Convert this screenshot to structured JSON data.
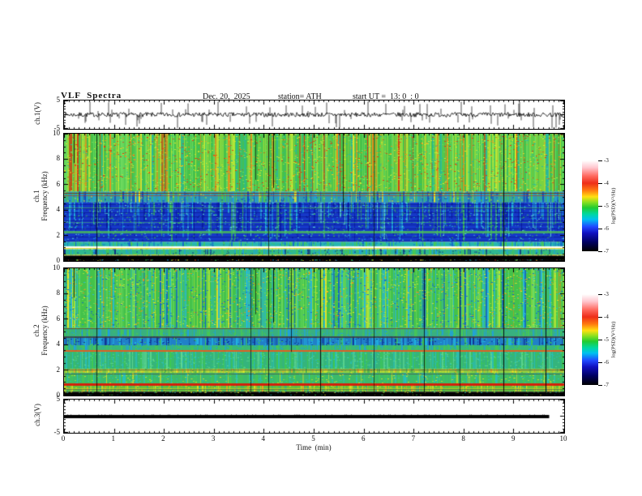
{
  "header": {
    "title": "VLF  Spectra",
    "date": "Dec. 20,  2025",
    "station": "station= ATH",
    "start_ut": "start UT =  13: 0  : 0"
  },
  "axes": {
    "time": {
      "label": "Time  (min)",
      "range": [
        0,
        10
      ],
      "ticks": [
        "0",
        "1",
        "2",
        "3",
        "4",
        "5",
        "6",
        "7",
        "8",
        "9",
        "10"
      ],
      "minor_step": 0.1
    },
    "ch1v": {
      "label": "ch.1(V)",
      "range": [
        -5,
        5
      ],
      "ticks": [
        "5",
        "-5"
      ],
      "tick_values": [
        5,
        -5
      ]
    },
    "ch1f": {
      "label_line1": "ch.1",
      "label_line2": "Frequency  (kHz)",
      "range": [
        0,
        10
      ],
      "ticks": [
        "10",
        "8",
        "6",
        "4",
        "2",
        "0"
      ],
      "tick_values": [
        10,
        8,
        6,
        4,
        2,
        0
      ],
      "minor_step": 0.5
    },
    "ch2f": {
      "label_line1": "ch.2",
      "label_line2": "Frequency  (kHz)",
      "range": [
        0,
        10
      ],
      "ticks": [
        "10",
        "8",
        "6",
        "4",
        "2",
        "0"
      ],
      "tick_values": [
        10,
        8,
        6,
        4,
        2,
        0
      ],
      "minor_step": 0.5
    },
    "ch3v": {
      "label": "ch.3(V)",
      "range": [
        -5,
        5
      ],
      "ticks": [
        "5",
        "-5"
      ],
      "tick_values": [
        5,
        -5
      ]
    }
  },
  "colorbar": {
    "label": "log(PSD)(V²/Hz)",
    "ticks": [
      "-3",
      "-4",
      "-5",
      "-6",
      "-7"
    ],
    "gradient": [
      [
        "#ffffff",
        0
      ],
      [
        "#ffc6ce",
        8
      ],
      [
        "#ff6a60",
        17
      ],
      [
        "#ee2e18",
        25
      ],
      [
        "#ff7a10",
        33
      ],
      [
        "#ffe010",
        40
      ],
      [
        "#8ae020",
        46
      ],
      [
        "#22cc30",
        52
      ],
      [
        "#00d8a0",
        59
      ],
      [
        "#00c0f0",
        65
      ],
      [
        "#2048ff",
        73
      ],
      [
        "#1010c0",
        80
      ],
      [
        "#000060",
        90
      ],
      [
        "#000000",
        100
      ]
    ]
  },
  "chart_data": [
    {
      "type": "line",
      "name": "ch1-voltage-waveform",
      "xlabel": "Time (min)",
      "xlim": [
        0,
        10
      ],
      "ylabel": "ch.1(V)",
      "ylim": [
        -5,
        5
      ],
      "color": "#000000",
      "seed": 7,
      "baseline": 0,
      "noise_amplitude": 0.8,
      "spike_probability": 0.13,
      "spike_min": 1.2,
      "spike_max": 4.8
    },
    {
      "type": "heatmap",
      "name": "ch1-spectrogram",
      "xlim": [
        0,
        10
      ],
      "f_range": [
        0,
        10
      ],
      "ylabel": "ch.1 Frequency (kHz)",
      "units": "log(PSD)(V²/Hz)",
      "scale_range": [
        -7,
        -3
      ],
      "seed": 11,
      "vseed": 42,
      "vline_prob": 0.035,
      "bands": [
        {
          "f": [
            5.45,
            10.0
          ],
          "base": "#46c24a",
          "mode": "full",
          "noise": 0.35,
          "streaks": [
            [
              "#b8e838",
              0.18
            ],
            [
              "#e8e428",
              0.13
            ],
            [
              "#f09018",
              0.1
            ],
            [
              "#e03410",
              0.07
            ],
            [
              "#70dc60",
              0.22
            ],
            [
              "#28b8a0",
              0.06
            ]
          ]
        },
        {
          "f": [
            4.6,
            5.45
          ],
          "base": "#2f9ab0",
          "mode": "full",
          "noise": 0.3,
          "streaks": [
            [
              "#48c850",
              0.25
            ],
            [
              "#20a0e0",
              0.18
            ],
            [
              "#e8e428",
              0.05
            ],
            [
              "#1040c0",
              0.15
            ]
          ]
        },
        {
          "f": [
            1.5,
            4.6
          ],
          "base": "#1638c8",
          "mode": "top",
          "noise": 0.32,
          "hstripe": {
            "step": 5,
            "color": "#071280",
            "alpha": 0.55
          },
          "streaks": [
            [
              "#20b4e0",
              0.2
            ],
            [
              "#40c850",
              0.12
            ],
            [
              "#0818a0",
              0.18
            ],
            [
              "#60e0d0",
              0.06
            ]
          ]
        },
        {
          "f": [
            1.15,
            1.5
          ],
          "base": "#28b6b0",
          "mode": "full",
          "noise": 0.3,
          "streaks": [
            [
              "#48c850",
              0.3
            ],
            [
              "#1060d0",
              0.15
            ]
          ]
        },
        {
          "f": [
            0.92,
            1.15
          ],
          "base": "#f0f0c0",
          "mode": "full",
          "noise": 0.2,
          "streaks": [
            [
              "#ffffff",
              0.3
            ],
            [
              "#f0e020",
              0.3
            ]
          ]
        },
        {
          "f": [
            0.5,
            0.92
          ],
          "base": "#30b890",
          "mode": "full",
          "noise": 0.35,
          "streaks": [
            [
              "#48c850",
              0.25
            ],
            [
              "#20a0e0",
              0.2
            ],
            [
              "#103080",
              0.1
            ]
          ]
        },
        {
          "f": [
            0.42,
            0.5
          ],
          "base": "#b0d040",
          "mode": "full",
          "noise": 0.2,
          "streaks": [
            [
              "#e0e020",
              0.3
            ],
            [
              "#40a040",
              0.2
            ]
          ]
        },
        {
          "f": [
            0.0,
            0.42
          ],
          "base": "#0a0a0a",
          "mode": "dots",
          "noise": 0.55,
          "streaks": [
            [
              "#40c850",
              0.1
            ],
            [
              "#e03410",
              0.05
            ],
            [
              "#20a0e0",
              0.07
            ],
            [
              "#e8e428",
              0.04
            ]
          ]
        }
      ],
      "hlines": [
        {
          "f": 5.35,
          "color": "#803010",
          "px": 1,
          "alpha": 0.85
        },
        {
          "f": 5.12,
          "color": "#c03818",
          "px": 1,
          "alpha": 0.65
        },
        {
          "f": 4.15,
          "color": "#58d058",
          "px": 1,
          "alpha": 0.55
        },
        {
          "f": 3.05,
          "color": "#58d058",
          "px": 1,
          "alpha": 0.45
        },
        {
          "f": 2.25,
          "color": "#50cc50",
          "px": 3,
          "alpha": 0.75
        },
        {
          "f": 1.1,
          "color": "#ffffff",
          "px": 2,
          "alpha": 0.9
        },
        {
          "f": 0.98,
          "color": "#e8d820",
          "px": 1,
          "alpha": 0.9
        },
        {
          "f": 0.3,
          "color": "#000000",
          "px": 2,
          "alpha": 1
        },
        {
          "f": 0.18,
          "color": "#000000",
          "px": 2,
          "alpha": 1
        }
      ]
    },
    {
      "type": "heatmap",
      "name": "ch2-spectrogram",
      "xlim": [
        0,
        10
      ],
      "f_range": [
        0,
        10
      ],
      "ylabel": "ch.2 Frequency (kHz)",
      "units": "log(PSD)(V²/Hz)",
      "scale_range": [
        -7,
        -3
      ],
      "seed": 23,
      "vseed": 42,
      "vline_prob": 0.05,
      "bands": [
        {
          "f": [
            5.3,
            10.0
          ],
          "base": "#44c24a",
          "mode": "full",
          "noise": 0.35,
          "streaks": [
            [
              "#28b8d8",
              0.22
            ],
            [
              "#1060d0",
              0.12
            ],
            [
              "#b8e838",
              0.12
            ],
            [
              "#e8e428",
              0.07
            ],
            [
              "#70dc60",
              0.2
            ],
            [
              "#f09018",
              0.03
            ]
          ]
        },
        {
          "f": [
            4.65,
            5.3
          ],
          "base": "#38b080",
          "mode": "full",
          "noise": 0.3,
          "streaks": [
            [
              "#48c850",
              0.25
            ],
            [
              "#20a0e0",
              0.2
            ]
          ]
        },
        {
          "f": [
            3.95,
            4.65
          ],
          "base": "#2080c8",
          "mode": "full",
          "noise": 0.35,
          "streaks": [
            [
              "#20b4e0",
              0.25
            ],
            [
              "#103090",
              0.2
            ],
            [
              "#40c850",
              0.1
            ]
          ]
        },
        {
          "f": [
            3.55,
            3.95
          ],
          "base": "#38b878",
          "mode": "full",
          "noise": 0.3,
          "streaks": [
            [
              "#48c850",
              0.3
            ],
            [
              "#20a0e0",
              0.15
            ]
          ]
        },
        {
          "f": [
            2.1,
            3.45
          ],
          "base": "#34b47c",
          "mode": "full",
          "noise": 0.4,
          "streaks": [
            [
              "#40c850",
              0.22
            ],
            [
              "#28c0c0",
              0.25
            ],
            [
              "#60d890",
              0.15
            ]
          ]
        },
        {
          "f": [
            1.78,
            2.1
          ],
          "base": "#90cc40",
          "mode": "full",
          "noise": 0.3,
          "streaks": [
            [
              "#d8e028",
              0.3
            ],
            [
              "#f0a020",
              0.08
            ],
            [
              "#50b048",
              0.2
            ]
          ]
        },
        {
          "f": [
            0.95,
            1.78
          ],
          "base": "#3cba6a",
          "mode": "full",
          "noise": 0.4,
          "streaks": [
            [
              "#48c850",
              0.25
            ],
            [
              "#28c0c0",
              0.18
            ],
            [
              "#d8e028",
              0.07
            ]
          ]
        },
        {
          "f": [
            0.3,
            0.95
          ],
          "base": "#62c23c",
          "mode": "full",
          "noise": 0.35,
          "streaks": [
            [
              "#d8e028",
              0.2
            ],
            [
              "#f0a020",
              0.08
            ],
            [
              "#30b080",
              0.15
            ]
          ]
        },
        {
          "f": [
            0.0,
            0.3
          ],
          "base": "#0a0a0a",
          "mode": "dots",
          "noise": 0.55,
          "streaks": [
            [
              "#40c850",
              0.1
            ],
            [
              "#28c0c0",
              0.08
            ],
            [
              "#d8e028",
              0.05
            ]
          ]
        }
      ],
      "hlines": [
        {
          "f": 5.25,
          "color": "#604020",
          "px": 1,
          "alpha": 0.8
        },
        {
          "f": 4.6,
          "color": "#404040",
          "px": 2,
          "alpha": 0.85
        },
        {
          "f": 3.5,
          "color": "#e05010",
          "px": 2,
          "alpha": 0.9
        },
        {
          "f": 2.0,
          "color": "#484848",
          "px": 1,
          "alpha": 0.7
        },
        {
          "f": 1.7,
          "color": "#484848",
          "px": 1,
          "alpha": 0.7
        },
        {
          "f": 0.95,
          "color": "#e8d820",
          "px": 1,
          "alpha": 0.7
        },
        {
          "f": 0.85,
          "color": "#d81808",
          "px": 3,
          "alpha": 0.95
        },
        {
          "f": 0.55,
          "color": "#c8d820",
          "px": 1,
          "alpha": 0.7
        },
        {
          "f": 0.45,
          "color": "#505050",
          "px": 1,
          "alpha": 0.6
        },
        {
          "f": 0.15,
          "color": "#000000",
          "px": 2,
          "alpha": 1
        }
      ]
    },
    {
      "type": "line",
      "name": "ch3-voltage-flatline",
      "xlabel": "Time (min)",
      "xlim": [
        0,
        10
      ],
      "ylabel": "ch.3(V)",
      "ylim": [
        -5,
        5
      ],
      "color": "#000000",
      "seed": 5,
      "value": 0,
      "x_start": 0,
      "x_end": 9.7,
      "thickness_px": 4
    }
  ]
}
